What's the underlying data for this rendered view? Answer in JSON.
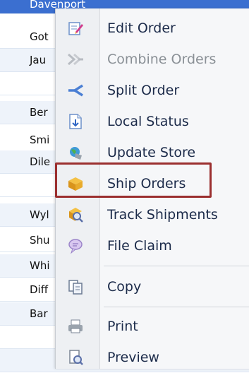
{
  "grid": {
    "rows": [
      {
        "text": "Davenport",
        "style": "sel"
      },
      {
        "text": "Got",
        "style": "plain"
      },
      {
        "text": "Jau",
        "style": "alt"
      },
      {
        "text": "",
        "style": "plain"
      },
      {
        "text": "Ber",
        "style": "alt"
      },
      {
        "text": "Smi",
        "style": "plain"
      },
      {
        "text": "Dile",
        "style": "alt"
      },
      {
        "text": "",
        "style": "plain"
      },
      {
        "text": "Wyl",
        "style": "alt"
      },
      {
        "text": "Shu",
        "style": "plain"
      },
      {
        "text": "Whi",
        "style": "alt"
      },
      {
        "text": "Diff",
        "style": "plain"
      },
      {
        "text": "Bar",
        "style": "alt"
      },
      {
        "text": "",
        "style": "plain"
      },
      {
        "text": "",
        "style": "alt"
      }
    ]
  },
  "menu": {
    "items": [
      {
        "label": "Edit Order",
        "icon": "edit-order-icon",
        "enabled": true
      },
      {
        "label": "Combine Orders",
        "icon": "combine-orders-icon",
        "enabled": false
      },
      {
        "label": "Split Order",
        "icon": "split-order-icon",
        "enabled": true
      },
      {
        "label": "Local Status",
        "icon": "local-status-icon",
        "enabled": true
      },
      {
        "label": "Update Store",
        "icon": "update-store-icon",
        "enabled": true
      },
      {
        "label": "Ship Orders",
        "icon": "ship-orders-icon",
        "enabled": true
      },
      {
        "label": "Track Shipments",
        "icon": "track-shipments-icon",
        "enabled": true
      },
      {
        "label": "File Claim",
        "icon": "file-claim-icon",
        "enabled": true
      },
      {
        "label": "Copy",
        "icon": "copy-icon",
        "enabled": true
      },
      {
        "label": "Print",
        "icon": "print-icon",
        "enabled": true
      },
      {
        "label": "Preview",
        "icon": "preview-icon",
        "enabled": true
      }
    ],
    "highlighted_item": "Ship Orders"
  },
  "colors": {
    "selection_row": "#3b6fd0",
    "highlight_box": "#9b2f2f",
    "menu_text": "#1c2b4a",
    "disabled_text": "#8a9096"
  }
}
